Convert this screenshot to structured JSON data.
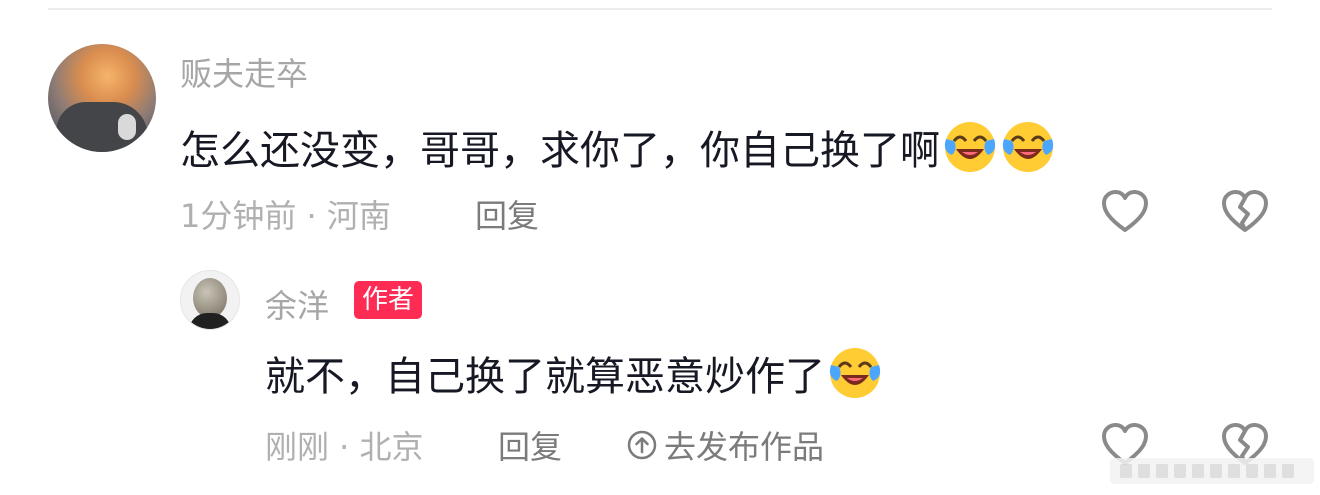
{
  "comment": {
    "username": "贩夫走卒",
    "text": "怎么还没变，哥哥，求你了，你自己换了啊",
    "emojis": [
      "laughing-crying-emoji",
      "laughing-crying-emoji"
    ],
    "time_location": "1分钟前 · 河南",
    "reply_label": "回复"
  },
  "reply": {
    "username": "余洋",
    "badge": "作者",
    "text": "就不，自己换了就算恶意炒作了",
    "emojis": [
      "laughing-crying-emoji"
    ],
    "time_location": "刚刚 · 北京",
    "reply_label": "回复",
    "publish_label": "去发布作品"
  },
  "colors": {
    "badge": "#fe2c55",
    "primary_text": "#161823",
    "secondary_text": "#a6a6a6",
    "action_text": "#7b7b7b"
  }
}
